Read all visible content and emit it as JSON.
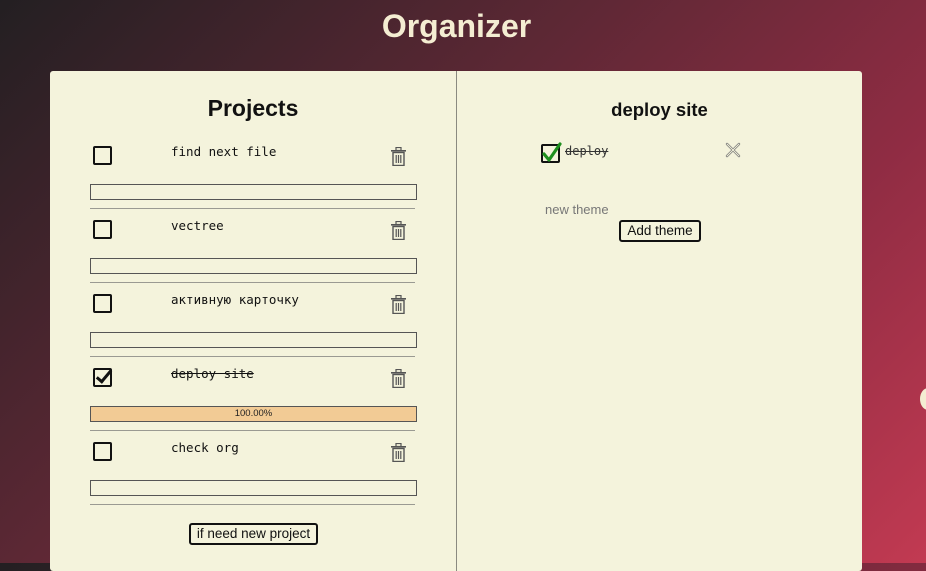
{
  "app": {
    "title": "Organizer"
  },
  "projects_panel": {
    "title": "Projects",
    "new_project_label": "if need new project",
    "items": [
      {
        "name": "find next file",
        "done": false,
        "progress_label": "",
        "progress": 0
      },
      {
        "name": "vectree",
        "done": false,
        "progress_label": "",
        "progress": 0
      },
      {
        "name": "активную карточку",
        "done": false,
        "progress_label": "",
        "progress": 0
      },
      {
        "name": "deploy site",
        "done": true,
        "progress_label": "100.00%",
        "progress": 100
      },
      {
        "name": "check org",
        "done": false,
        "progress_label": "",
        "progress": 0
      }
    ]
  },
  "detail_panel": {
    "title": "deploy site",
    "themes": [
      {
        "text": "deploy",
        "done": true
      }
    ],
    "new_theme_placeholder": "new theme",
    "add_theme_label": "Add theme"
  },
  "colors": {
    "panel_bg": "#f4f3dc",
    "progress_fill": "#f2cb95",
    "title_text": "#f4edd2",
    "check_green": "#1e8f1e"
  },
  "icons": {
    "delete": "trash-icon",
    "remove_theme": "close-icon",
    "checked": "checkmark-icon"
  }
}
